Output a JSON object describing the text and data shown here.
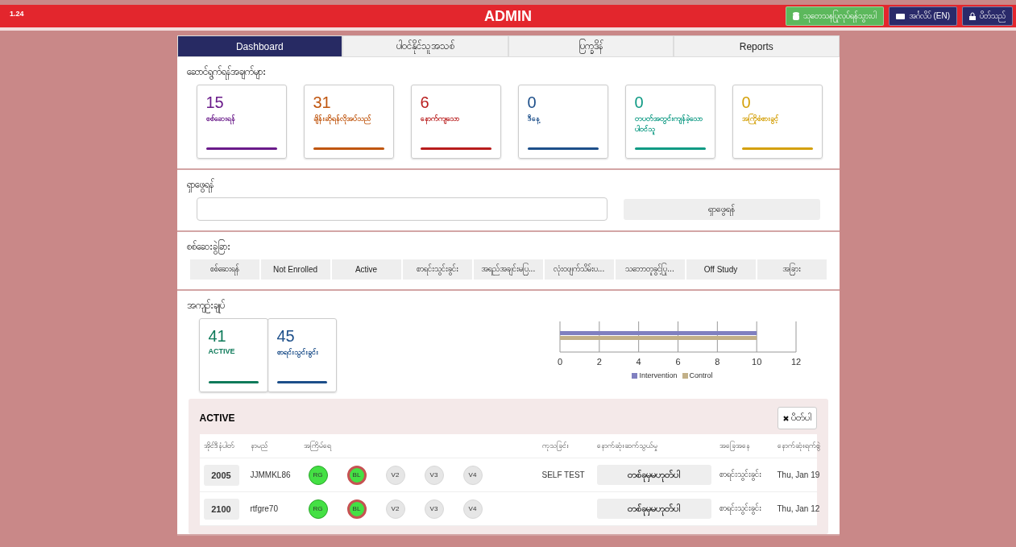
{
  "header": {
    "version": "1.24",
    "title": "ADMIN",
    "buttons": [
      {
        "kind": "research",
        "label": "သုတေသနပြုလုပ်ရန်သွားပါ"
      },
      {
        "kind": "language",
        "label": "အင်္ဂလိပ် (EN)"
      },
      {
        "kind": "logout",
        "label": "ပိတ်သည်"
      }
    ]
  },
  "tabs": [
    {
      "label": "Dashboard",
      "selected": true
    },
    {
      "label": "ပါဝင်နိုင်သူအသစ်",
      "selected": false
    },
    {
      "label": "ပြက္ခဒိန်",
      "selected": false
    },
    {
      "label": "Reports",
      "selected": false
    }
  ],
  "tasks": {
    "title": "ဆောင်ရွက်ရန်အချက်များ",
    "cards": [
      {
        "count": "15",
        "label": "စစ်ဆေးရန်",
        "color": "#6a1b8a"
      },
      {
        "count": "31",
        "label": "ချိန်းဆိုရန်လိုအပ်သည်",
        "color": "#c0560f"
      },
      {
        "count": "6",
        "label": "နောက်ကျသော",
        "color": "#b81c1c"
      },
      {
        "count": "0",
        "label": "ဒီနေ့",
        "color": "#1d4f8a"
      },
      {
        "count": "0",
        "label": "တပတ်အတွင်းကျန်ခဲ့သောပါဝင်သူ",
        "color": "#0f9a84"
      },
      {
        "count": "0",
        "label": "အကြိုစံစားခွင့်",
        "color": "#d4a00a"
      }
    ]
  },
  "search": {
    "title": "ရှာဖွေရန်",
    "button": "ရှာဖွေရန်"
  },
  "filters": {
    "title": "စစ်ဆေးခွဲခြား",
    "items": [
      "စစ်ဆေးရန်",
      "Not Enrolled",
      "Active",
      "စာရင်းသွင်းခွင်း",
      "အရည်အချင်းမပြ...",
      "လုံးဝဖျက်သိမ်းပ...",
      "သဘောတူခွင့်ပြု...",
      "Off Study",
      "အခြား"
    ]
  },
  "summary": {
    "title": "အကျဉ်းချုပ်",
    "cards": [
      {
        "count": "41",
        "label": "ACTIVE",
        "color": "#0e7a5a"
      },
      {
        "count": "45",
        "label": "စာရင်းသွင်းခွင်း",
        "color": "#1d4f8a"
      }
    ],
    "chart_data": {
      "type": "bar",
      "orientation": "horizontal",
      "grid": true,
      "series": [
        {
          "name": "Intervention",
          "color": "#8080c0",
          "values": [
            10
          ]
        },
        {
          "name": "Control",
          "color": "#c2b088",
          "values": [
            10
          ]
        }
      ],
      "xlim": [
        0,
        12
      ],
      "xticks": [
        0,
        2,
        4,
        6,
        8,
        10,
        12
      ]
    }
  },
  "table": {
    "title": "ACTIVE",
    "close": "ပိတ်ပါ",
    "columns": [
      "အိုင်ဒီနံပါတ်",
      "နာမည်",
      "အကြိမ်ရေ",
      "ကုသခြင်း",
      "နောက်ဆုံးဆက်သွယ်မှု",
      "အခြေအနေ",
      "နောက်ဆုံးရက်စွဲ"
    ],
    "rows": [
      {
        "id": "2005",
        "name": "JJMMKL86",
        "visits": [
          {
            "label": "RG",
            "completed": true,
            "alert": false
          },
          {
            "label": "BL",
            "completed": true,
            "alert": true
          },
          {
            "label": "V2",
            "completed": false,
            "alert": false
          },
          {
            "label": "V3",
            "completed": false,
            "alert": false
          },
          {
            "label": "V4",
            "completed": false,
            "alert": false
          }
        ],
        "treatment": "SELF TEST",
        "contact": "တစ်ခုမှမဟုတ်ပါ",
        "status": "စာရင်းသွင်းခွင်း",
        "date": "Thu, Jan 19"
      },
      {
        "id": "2100",
        "name": "rtfgre70",
        "visits": [
          {
            "label": "RG",
            "completed": true,
            "alert": false
          },
          {
            "label": "BL",
            "completed": true,
            "alert": true
          },
          {
            "label": "V2",
            "completed": false,
            "alert": false
          },
          {
            "label": "V3",
            "completed": false,
            "alert": false
          },
          {
            "label": "V4",
            "completed": false,
            "alert": false
          }
        ],
        "contact": "တစ်ခုမှမဟုတ်ပါ",
        "status": "စာရင်းသွင်းခွင်း",
        "date": "Thu, Jan 12"
      }
    ]
  }
}
